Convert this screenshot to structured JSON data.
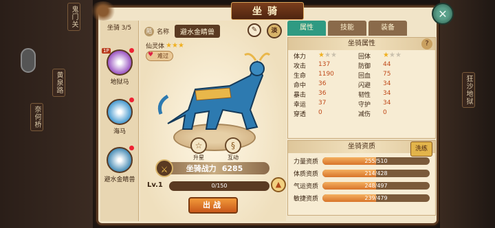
{
  "window": {
    "title": "坐骑"
  },
  "side_tags": {
    "left": [
      "鬼门关",
      "黄泉路",
      "奈何桥"
    ],
    "right": [
      "狂沙地狱"
    ]
  },
  "mount_list": {
    "count": "坐骑 3/5",
    "items": [
      {
        "name": "地狱马",
        "badge": "1P",
        "color": "#8a3ab8"
      },
      {
        "name": "海马",
        "badge": "",
        "color": "#2a8ac8"
      },
      {
        "name": "避水金睛兽",
        "badge": "",
        "color": "#2a7aaa"
      }
    ]
  },
  "detail": {
    "name_chip": "陌",
    "name_label": "名称",
    "name_value": "避水金睛兽",
    "edit_icon": "✎",
    "seal": "淡",
    "rank_label": "仙灵体",
    "rank_stars": 3,
    "tag": "难过",
    "actions": [
      {
        "label": "升星",
        "icon": "☆"
      },
      {
        "label": "互动",
        "icon": "§"
      }
    ],
    "power_label": "坐骑战力",
    "power_value": "6285",
    "level": "Lv.1",
    "exp": "0/150",
    "fight_button": "出战"
  },
  "tabs": [
    "属性",
    "技能",
    "装备"
  ],
  "attributes": {
    "title": "坐骑属性",
    "rows": [
      [
        {
          "k": "体力",
          "v": "",
          "stars": 1
        },
        {
          "k": "回体",
          "v": "",
          "stars": 1
        }
      ],
      [
        {
          "k": "攻击",
          "v": "137"
        },
        {
          "k": "防御",
          "v": "44"
        }
      ],
      [
        {
          "k": "生命",
          "v": "1190"
        },
        {
          "k": "回血",
          "v": "75"
        }
      ],
      [
        {
          "k": "命中",
          "v": "36"
        },
        {
          "k": "闪避",
          "v": "34"
        }
      ],
      [
        {
          "k": "暴击",
          "v": "36"
        },
        {
          "k": "韧性",
          "v": "34"
        }
      ],
      [
        {
          "k": "幸运",
          "v": "37"
        },
        {
          "k": "守护",
          "v": "34"
        }
      ],
      [
        {
          "k": "穿透",
          "v": "0"
        },
        {
          "k": "减伤",
          "v": "0"
        }
      ]
    ]
  },
  "quality": {
    "title": "坐骑资质",
    "wash_button": "洗练",
    "rows": [
      {
        "label": "力量资质",
        "text": "255/510",
        "cur": 255,
        "max": 510
      },
      {
        "label": "体质资质",
        "text": "214/428",
        "cur": 214,
        "max": 428
      },
      {
        "label": "气运资质",
        "text": "248/497",
        "cur": 248,
        "max": 497
      },
      {
        "label": "敏捷资质",
        "text": "239/479",
        "cur": 239,
        "max": 479
      }
    ]
  }
}
